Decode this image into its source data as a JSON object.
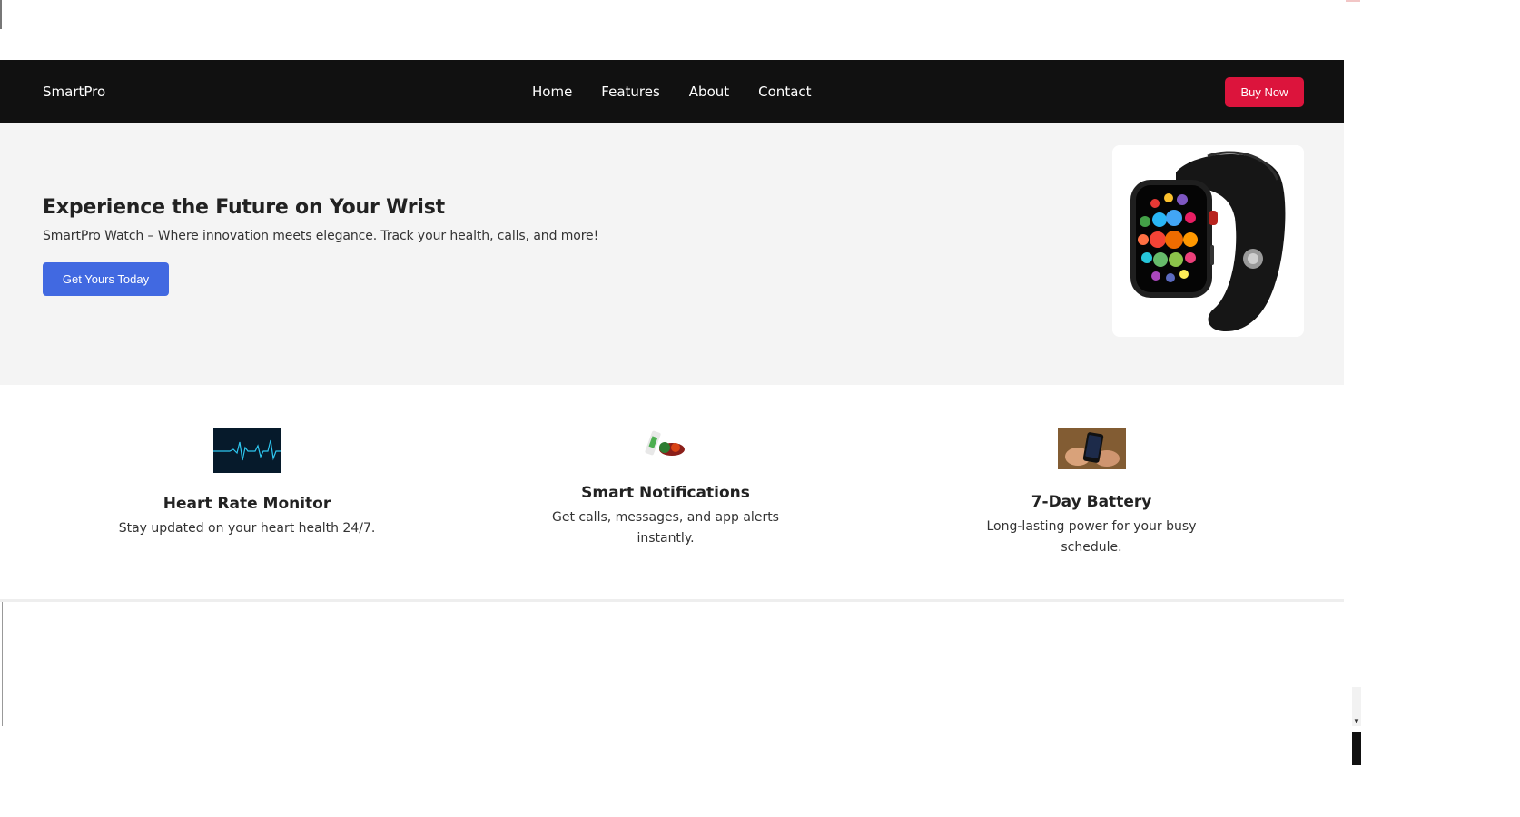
{
  "colors": {
    "navbar_bg": "#111111",
    "buy_button": "#dc143c",
    "hero_button": "#4169e1",
    "hero_bg": "#f4f4f4"
  },
  "navbar": {
    "brand": "SmartPro",
    "links": [
      "Home",
      "Features",
      "About",
      "Contact"
    ],
    "buy_label": "Buy Now"
  },
  "hero": {
    "title": "Experience the Future on Your Wrist",
    "subtitle": "SmartPro Watch – Where innovation meets elegance. Track your health, calls, and more!",
    "cta_label": "Get Yours Today",
    "image_icon": "smartwatch-image"
  },
  "features": [
    {
      "icon": "heartbeat-image",
      "title": "Heart Rate Monitor",
      "desc_lines": [
        "Stay updated on your heart health 24/7."
      ]
    },
    {
      "icon": "notification-image",
      "title": "Smart Notifications",
      "desc_lines": [
        "Get calls, messages, and app alerts",
        "instantly."
      ]
    },
    {
      "icon": "phone-battery-image",
      "title": "7-Day Battery",
      "desc_lines": [
        "Long-lasting power for your busy",
        "schedule."
      ]
    }
  ]
}
